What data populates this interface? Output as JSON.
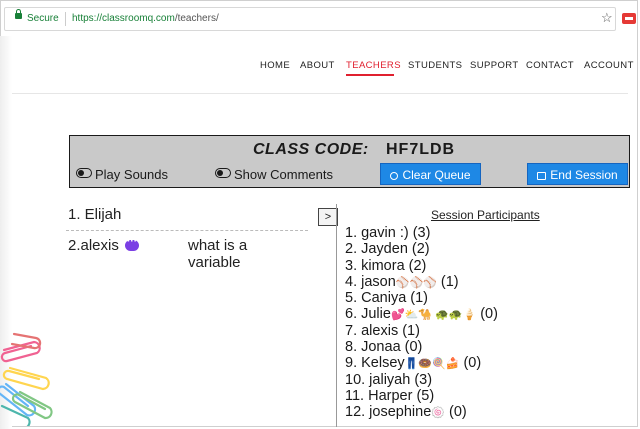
{
  "browser": {
    "secure_label": "Secure",
    "url_host": "https://classroomq.com",
    "url_path": "/teachers/"
  },
  "nav": {
    "items": [
      "HOME",
      "ABOUT",
      "TEACHERS",
      "STUDENTS",
      "SUPPORT",
      "CONTACT",
      "ACCOUNT"
    ],
    "active": "TEACHERS",
    "active_color": "#e0202f"
  },
  "session": {
    "code_label": "CLASS CODE:",
    "code_value": "HF7LDB",
    "toggle_sounds": "Play Sounds",
    "toggle_comments": "Show Comments",
    "clear_queue": "Clear Queue",
    "end_session": "End Session",
    "button_color": "#1e88e5"
  },
  "queue": {
    "item1": "1. Elijah",
    "item2_name": "2.alexis",
    "item2_comment": "what is a variable",
    "advance_label": ">"
  },
  "participants": {
    "heading": "Session Participants",
    "items": [
      {
        "text": "1. gavin :) (3)",
        "emoji": ""
      },
      {
        "text": "2. Jayden (2)",
        "emoji": ""
      },
      {
        "text": "3. kimora (2)",
        "emoji": ""
      },
      {
        "text": "4. jason",
        "emoji": "⚾⚾⚾",
        "suffix": " (1)"
      },
      {
        "text": "5. Caniya (1)",
        "emoji": ""
      },
      {
        "text": "6. Julie",
        "emoji": "💕⛅🐪 🐢🐢🍦",
        "suffix": " (0)"
      },
      {
        "text": "7. alexis (1)",
        "emoji": ""
      },
      {
        "text": "8. Jonaa (0)",
        "emoji": ""
      },
      {
        "text": "9. Kelsey",
        "emoji": "👖🍩🍭🍰",
        "suffix": " (0)"
      },
      {
        "text": "10. jaliyah (3)",
        "emoji": ""
      },
      {
        "text": "11. Harper (5)",
        "emoji": ""
      },
      {
        "text": "12. josephine",
        "emoji": "🍥",
        "suffix": " (0)"
      }
    ]
  }
}
